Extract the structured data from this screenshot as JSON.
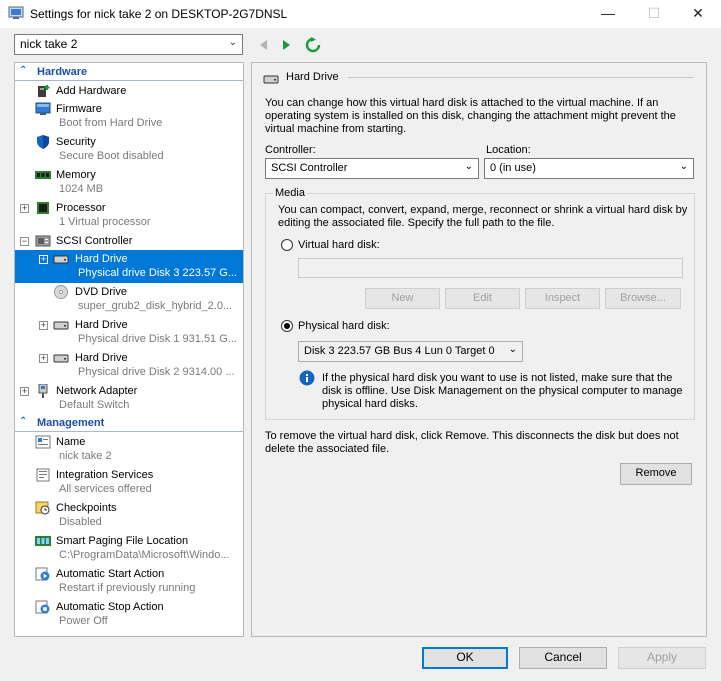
{
  "window": {
    "title": "Settings for nick take 2 on DESKTOP-2G7DNSL",
    "minimize": "—",
    "maximize": "☐",
    "close": "✕"
  },
  "vm_selector": {
    "value": "nick take 2"
  },
  "tree": {
    "hardware_header": "Hardware",
    "management_header": "Management",
    "hardware_items": [
      {
        "name": "Add Hardware",
        "sub": ""
      },
      {
        "name": "Firmware",
        "sub": "Boot from Hard Drive"
      },
      {
        "name": "Security",
        "sub": "Secure Boot disabled"
      },
      {
        "name": "Memory",
        "sub": "1024 MB"
      },
      {
        "name": "Processor",
        "sub": "1 Virtual processor"
      },
      {
        "name": "SCSI Controller",
        "sub": ""
      },
      {
        "name": "Hard Drive",
        "sub": "Physical drive Disk 3 223.57 G..."
      },
      {
        "name": "DVD Drive",
        "sub": "super_grub2_disk_hybrid_2.0..."
      },
      {
        "name": "Hard Drive",
        "sub": "Physical drive Disk 1 931.51 G..."
      },
      {
        "name": "Hard Drive",
        "sub": "Physical drive Disk 2 9314.00 ..."
      },
      {
        "name": "Network Adapter",
        "sub": "Default Switch"
      }
    ],
    "management_items": [
      {
        "name": "Name",
        "sub": "nick take 2"
      },
      {
        "name": "Integration Services",
        "sub": "All services offered"
      },
      {
        "name": "Checkpoints",
        "sub": "Disabled"
      },
      {
        "name": "Smart Paging File Location",
        "sub": "C:\\ProgramData\\Microsoft\\Windo..."
      },
      {
        "name": "Automatic Start Action",
        "sub": "Restart if previously running"
      },
      {
        "name": "Automatic Stop Action",
        "sub": "Power Off"
      }
    ]
  },
  "panel": {
    "heading": "Hard Drive",
    "intro": "You can change how this virtual hard disk is attached to the virtual machine. If an operating system is installed on this disk, changing the attachment might prevent the virtual machine from starting.",
    "controller_label": "Controller:",
    "controller_value": "SCSI Controller",
    "location_label": "Location:",
    "location_value": "0 (in use)",
    "media_label": "Media",
    "media_desc": "You can compact, convert, expand, merge, reconnect or shrink a virtual hard disk by editing the associated file. Specify the full path to the file.",
    "virtual_disk_label": "Virtual hard disk:",
    "virtual_disk_path": "",
    "btn_new": "New",
    "btn_edit": "Edit",
    "btn_inspect": "Inspect",
    "btn_browse": "Browse...",
    "physical_disk_label": "Physical hard disk:",
    "physical_disk_value": "Disk 3 223.57 GB Bus 4 Lun 0 Target 0",
    "info_text": "If the physical hard disk you want to use is not listed, make sure that the disk is offline. Use Disk Management on the physical computer to manage physical hard disks.",
    "remove_text": "To remove the virtual hard disk, click Remove. This disconnects the disk but does not delete the associated file.",
    "btn_remove": "Remove"
  },
  "footer": {
    "ok": "OK",
    "cancel": "Cancel",
    "apply": "Apply"
  },
  "colors": {
    "selection": "#0078d7",
    "accent": "#1a4fa5",
    "nav_green": "#1e9b3c"
  }
}
